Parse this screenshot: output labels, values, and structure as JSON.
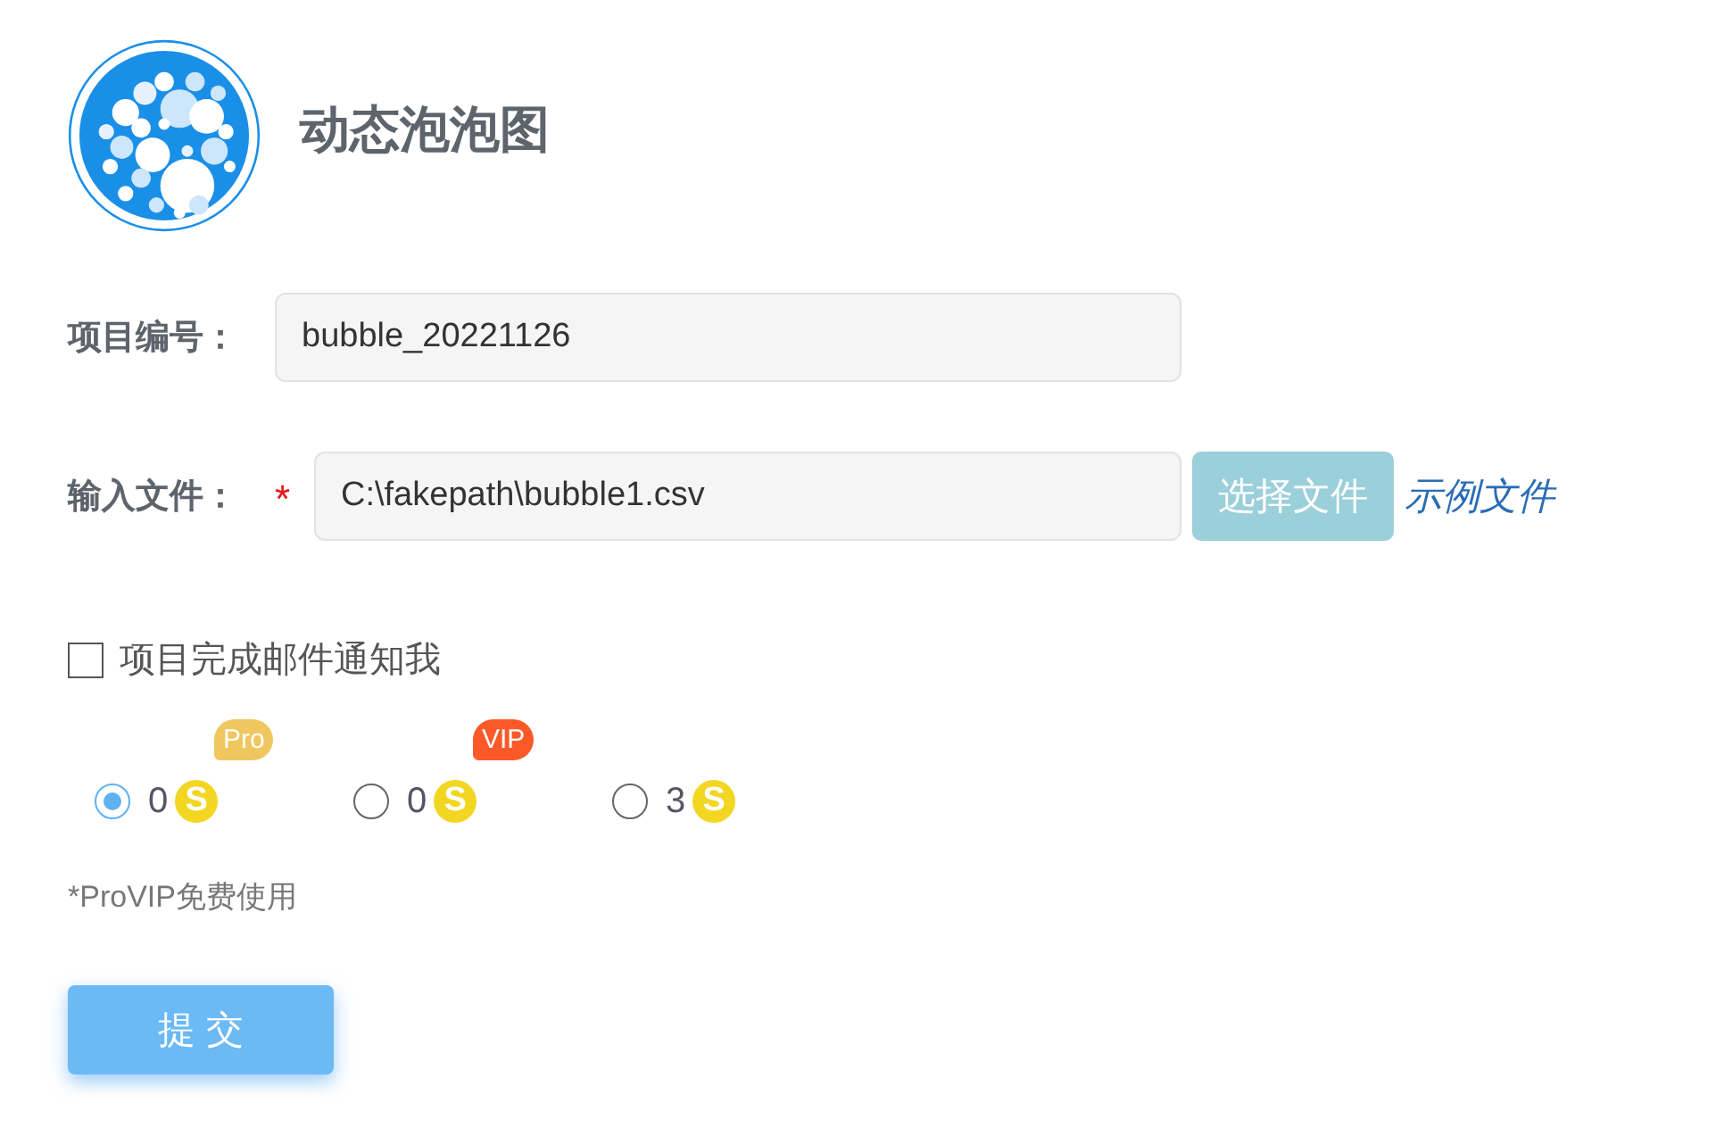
{
  "header": {
    "title": "动态泡泡图"
  },
  "fields": [
    {
      "kind": "text",
      "label": "项目编号：",
      "required": false,
      "value": "bubble_20221126"
    },
    {
      "kind": "file",
      "label": "输入文件：",
      "required": true,
      "required_mark": "*",
      "value": "C:\\fakepath\\bubble1.csv",
      "button": "选择文件",
      "link": "示例文件"
    }
  ],
  "notify": {
    "label": "项目完成邮件通知我",
    "checked": false
  },
  "plans": [
    {
      "price": "0",
      "coin": "S",
      "badge": "Pro",
      "color": "#f0c75e",
      "selected": true
    },
    {
      "price": "0",
      "coin": "S",
      "badge": "VIP",
      "color": "#fb5a28",
      "selected": false
    },
    {
      "price": "3",
      "coin": "S",
      "selected": false
    }
  ],
  "note": "*ProVIP免费使用",
  "submit": "提 交"
}
